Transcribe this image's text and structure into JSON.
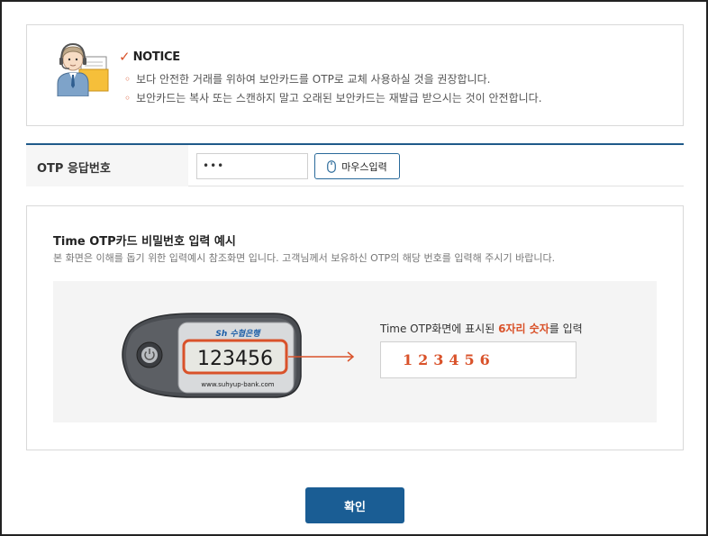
{
  "notice": {
    "title": "NOTICE",
    "items": [
      "보다 안전한 거래를 위하여 보안카드를 OTP로 교체 사용하실 것을 권장합니다.",
      "보안카드는 복사 또는 스캔하지 말고 오래된 보안카드는 재발급 받으시는 것이 안전합니다."
    ],
    "bullet": "◦"
  },
  "otp_form": {
    "label": "OTP 응답번호",
    "input_value": "•••",
    "mouse_input_label": "마우스입력"
  },
  "example": {
    "title": "Time OTP카드 비밀번호 입력 예시",
    "description": "본 화면은 이해를 돕기 위한 입력예시 참조화면 입니다. 고객님께서 보유하신 OTP의 해당 번호를 입력해 주시기 바랍니다.",
    "device": {
      "brand": "Sh 수협은행",
      "code": "123456",
      "url": "www.suhyup-bank.com"
    },
    "caption_prefix": "Time OTP화면에 표시된 ",
    "caption_highlight": "6자리 숫자",
    "caption_suffix": "를 입력",
    "input_example": "123456"
  },
  "confirm_label": "확인",
  "colors": {
    "accent_orange": "#d9522a",
    "primary_blue": "#1a5d94"
  }
}
